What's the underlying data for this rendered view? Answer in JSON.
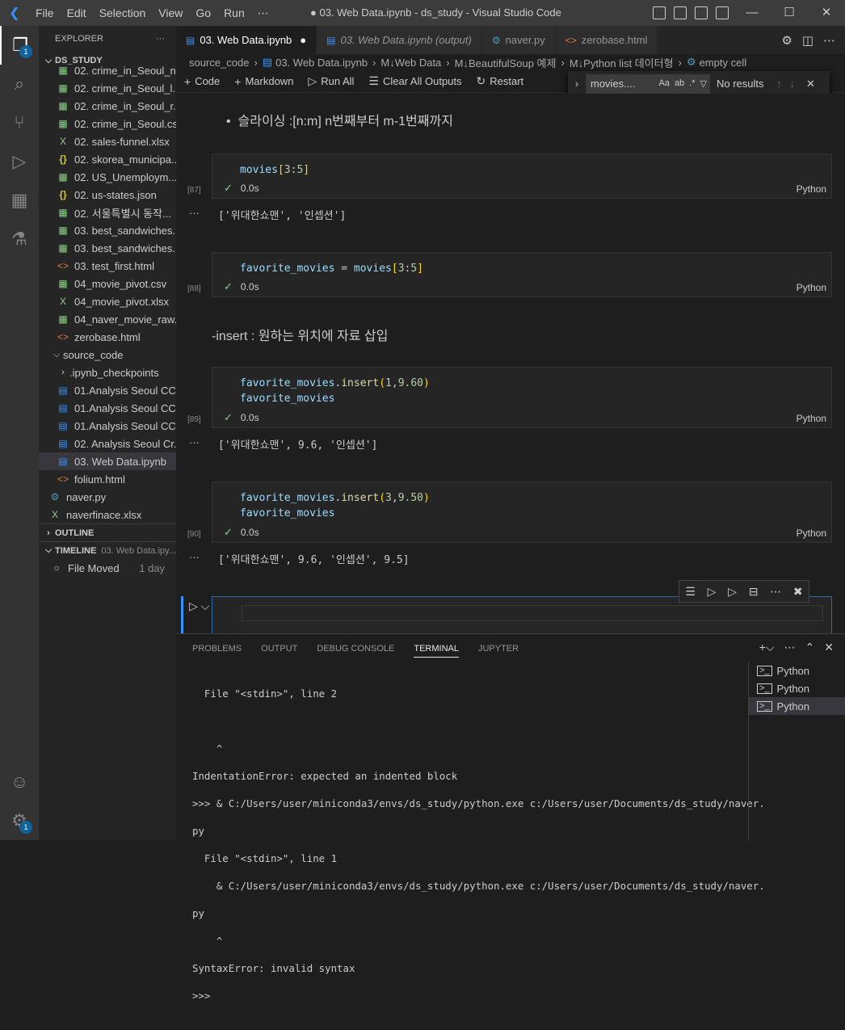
{
  "titlebar": {
    "menu": [
      "File",
      "Edit",
      "Selection",
      "View",
      "Go",
      "Run",
      "⋯"
    ],
    "title": "● 03. Web Data.ipynb - ds_study - Visual Studio Code",
    "minimize": "—",
    "maximize": "☐",
    "close": "✕"
  },
  "activitybar": {
    "explorer_badge": "1",
    "settings_badge": "1"
  },
  "sidebar": {
    "header": "EXPLORER",
    "header_more": "···",
    "root": "DS_STUDY",
    "files": [
      {
        "name": "02. crime_in_Seoul_n...",
        "icon": "csv"
      },
      {
        "name": "02. crime_in_Seoul_l...",
        "icon": "csv"
      },
      {
        "name": "02. crime_in_Seoul_r...",
        "icon": "csv"
      },
      {
        "name": "02. crime_in_Seoul.csv",
        "icon": "csv"
      },
      {
        "name": "02. sales-funnel.xlsx",
        "icon": "xls"
      },
      {
        "name": "02. skorea_municipa...",
        "icon": "json"
      },
      {
        "name": "02. US_Unemploym...",
        "icon": "csv"
      },
      {
        "name": "02. us-states.json",
        "icon": "json"
      },
      {
        "name": "02. 서울특별시 동작...",
        "icon": "csv"
      },
      {
        "name": "03. best_sandwiches...",
        "icon": "csv"
      },
      {
        "name": "03. best_sandwiches...",
        "icon": "csv"
      },
      {
        "name": "03. test_first.html",
        "icon": "html"
      },
      {
        "name": "04_movie_pivot.csv",
        "icon": "csv"
      },
      {
        "name": "04_movie_pivot.xlsx",
        "icon": "xls"
      },
      {
        "name": "04_naver_movie_raw...",
        "icon": "csv"
      },
      {
        "name": "zerobase.html",
        "icon": "html"
      }
    ],
    "source_code": {
      "label": "source_code",
      "checkpoints": ".ipynb_checkpoints",
      "items": [
        "01.Analysis Seoul CC...",
        "01.Analysis Seoul CC...",
        "01.Analysis Seoul CC...",
        "02. Analysis Seoul Cr...",
        "03. Web Data.ipynb"
      ],
      "folium": "folium.html"
    },
    "naver_py": "naver.py",
    "naverfinace": "naverfinace.xlsx",
    "outline": "OUTLINE",
    "timeline": "TIMELINE",
    "timeline_file": "03. Web Data.ipy...",
    "timeline_event": "File Moved",
    "timeline_when": "1 day"
  },
  "tabs": [
    {
      "label": "03. Web Data.ipynb",
      "icon": "notebook",
      "active": true,
      "dirty": "●"
    },
    {
      "label": "03. Web Data.ipynb (output)",
      "icon": "notebook",
      "active": false
    },
    {
      "label": "naver.py",
      "icon": "python",
      "active": false
    },
    {
      "label": "zerobase.html",
      "icon": "html",
      "active": false
    }
  ],
  "breadcrumb": [
    "source_code",
    "03. Web Data.ipynb",
    "M↓Web Data",
    "M↓BeautifulSoup 예제",
    "M↓Python list 데이터형",
    "empty cell"
  ],
  "nbtoolbar": {
    "code": "Code",
    "markdown": "Markdown",
    "run_all": "Run All",
    "clear": "Clear All Outputs",
    "restart": "Restart"
  },
  "find": {
    "value": "movies....",
    "opt_case": "Aa",
    "opt_word": "ab",
    "opt_regex": ".*",
    "result": "No results"
  },
  "notebook": {
    "md1": "슬라이싱 :[n:m] n번째부터 m-1번째까지",
    "cell87": {
      "exec": "[87]",
      "time": "0.0s",
      "lang": "Python",
      "output": "['위대한쇼맨', '인셉션']"
    },
    "cell88": {
      "exec": "[88]",
      "time": "0.0s",
      "lang": "Python"
    },
    "md2": "-insert : 원하는 위치에 자료 삽입",
    "cell89": {
      "exec": "[89]",
      "time": "0.0s",
      "lang": "Python",
      "output": "['위대한쇼맨', 9.6, '인셉션']"
    },
    "cell90": {
      "exec": "[90]",
      "time": "0.0s",
      "lang": "Python",
      "output": "['위대한쇼맨', 9.6, '인셉션', 9.5]"
    },
    "dots": "···"
  },
  "panel": {
    "tabs": [
      "PROBLEMS",
      "OUTPUT",
      "DEBUG CONSOLE",
      "TERMINAL",
      "JUPYTER"
    ],
    "active_tab": "TERMINAL",
    "terminal_lines": [
      "  File \"<stdin>\", line 2",
      "",
      "    ^",
      "IndentationError: expected an indented block",
      ">>> & C:/Users/user/miniconda3/envs/ds_study/python.exe c:/Users/user/Documents/ds_study/naver.",
      "py",
      "  File \"<stdin>\", line 1",
      "    & C:/Users/user/miniconda3/envs/ds_study/python.exe c:/Users/user/Documents/ds_study/naver.",
      "py",
      "    ^",
      "SyntaxError: invalid syntax",
      ">>> "
    ],
    "terminals": [
      "Python",
      "Python",
      "Python"
    ]
  },
  "colors": {
    "accent": "#3794ff",
    "success": "#89d185",
    "editor_bg": "#1e1e1e"
  }
}
